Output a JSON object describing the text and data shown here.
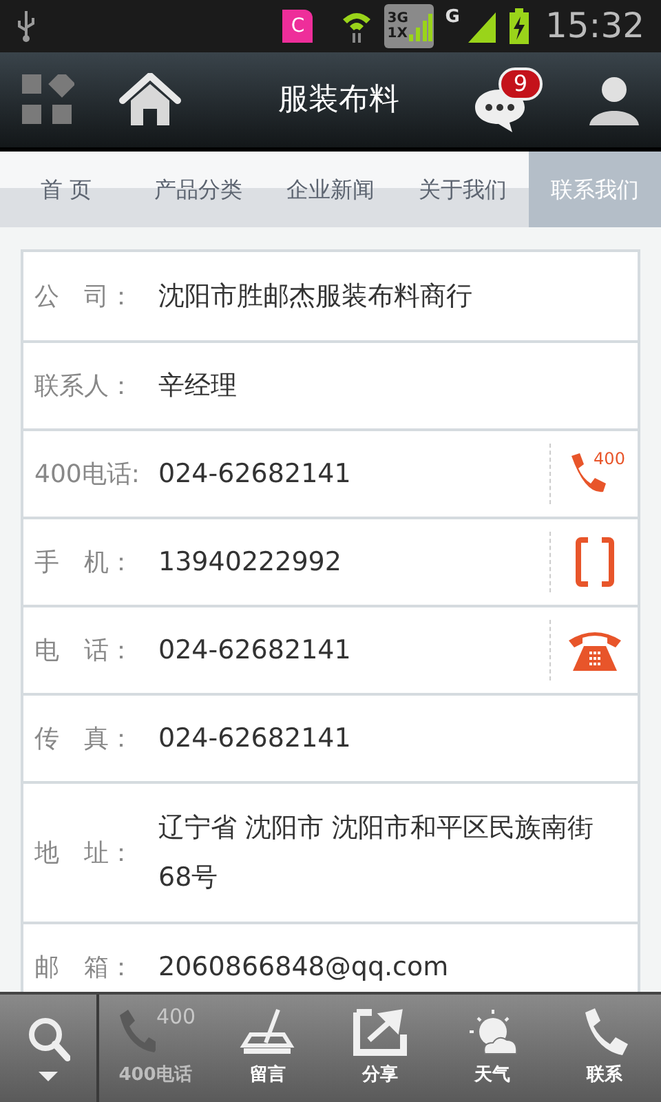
{
  "status_bar": {
    "notification_app": "C",
    "network_3g": "3G",
    "network_1x": "1X",
    "network_g": "G",
    "time": "15:32"
  },
  "header": {
    "title": "服装布料",
    "message_badge": "9"
  },
  "tabs": [
    {
      "label": "首 页",
      "selected": false
    },
    {
      "label": "产品分类",
      "selected": false
    },
    {
      "label": "企业新闻",
      "selected": false
    },
    {
      "label": "关于我们",
      "selected": false
    },
    {
      "label": "联系我们",
      "selected": true
    }
  ],
  "contact_rows": [
    {
      "label": "公　司：",
      "value": "沈阳市胜邮杰服装布料商行"
    },
    {
      "label": "联系人：",
      "value": "辛经理"
    },
    {
      "label": "400电话:",
      "value": "024-62682141",
      "kind": "hotline",
      "icon_text": "400"
    },
    {
      "label": "手　机：",
      "value": "13940222992",
      "kind": "mobile"
    },
    {
      "label": "电　话：",
      "value": "024-62682141",
      "kind": "phone"
    },
    {
      "label": "传　真：",
      "value": "024-62682141"
    },
    {
      "label": "地　址：",
      "value": "辽宁省 沈阳市 沈阳市和平区民族南街68号"
    },
    {
      "label": "邮　箱：",
      "value": "2060866848@qq.com"
    }
  ],
  "bottom_bar": [
    {
      "label": "400电话",
      "kind": "hotline",
      "disabled": true,
      "icon_text": "400"
    },
    {
      "label": "留言",
      "kind": "write",
      "disabled": false
    },
    {
      "label": "分享",
      "kind": "share",
      "disabled": false
    },
    {
      "label": "天气",
      "kind": "weather",
      "disabled": false
    },
    {
      "label": "联系",
      "kind": "call",
      "disabled": false
    }
  ]
}
